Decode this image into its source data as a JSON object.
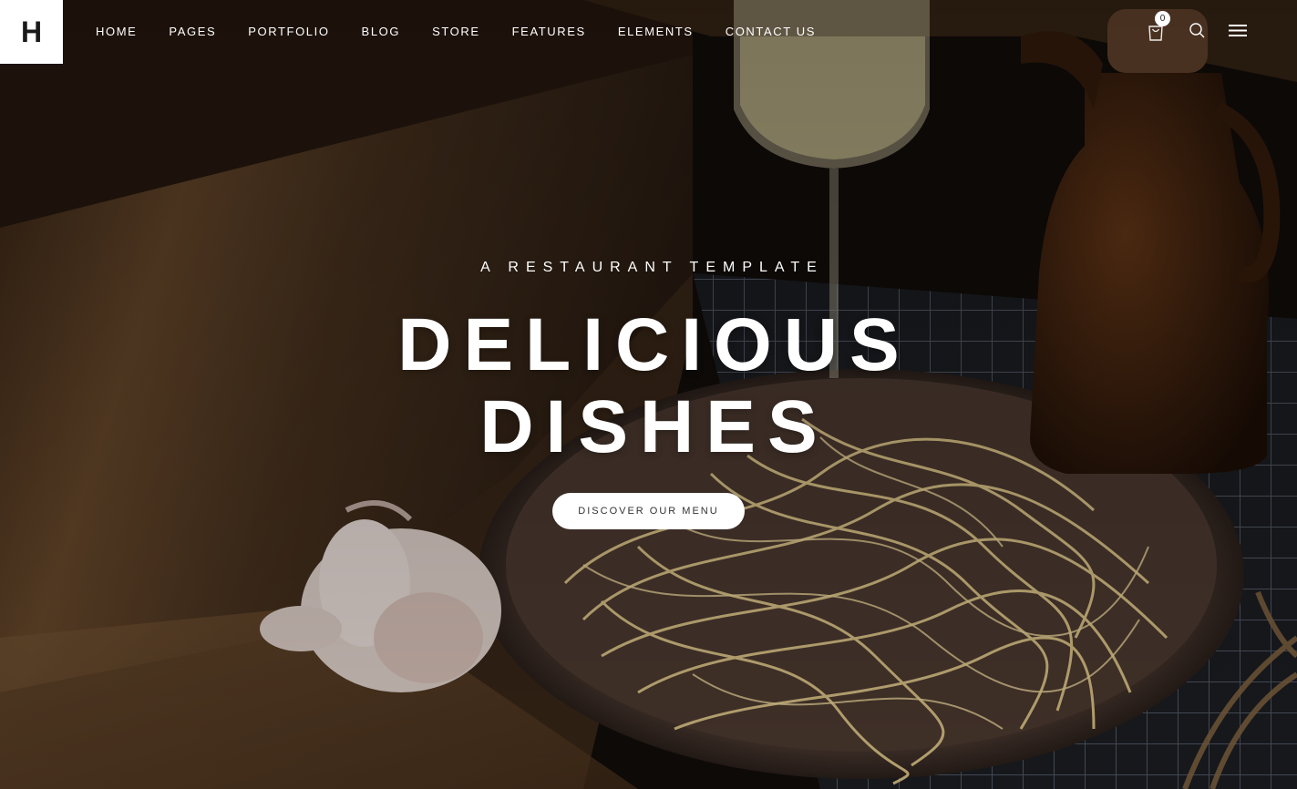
{
  "logo": {
    "letter": "H"
  },
  "nav": {
    "items": [
      {
        "label": "HOME"
      },
      {
        "label": "PAGES"
      },
      {
        "label": "PORTFOLIO"
      },
      {
        "label": "BLOG"
      },
      {
        "label": "STORE"
      },
      {
        "label": "FEATURES"
      },
      {
        "label": "ELEMENTS"
      },
      {
        "label": "CONTACT US"
      }
    ]
  },
  "header_icons": {
    "cart_icon": "cart-icon",
    "cart_count": "0",
    "search_icon": "search-icon",
    "menu_icon": "hamburger-menu-icon"
  },
  "hero": {
    "subtitle": "A RESTAURANT TEMPLATE",
    "title_line1": "DELICIOUS",
    "title_line2": "DISHES",
    "cta_label": "DISCOVER OUR MENU"
  },
  "colors": {
    "text": "#ffffff",
    "button_bg": "#ffffff",
    "button_text": "#333333"
  }
}
